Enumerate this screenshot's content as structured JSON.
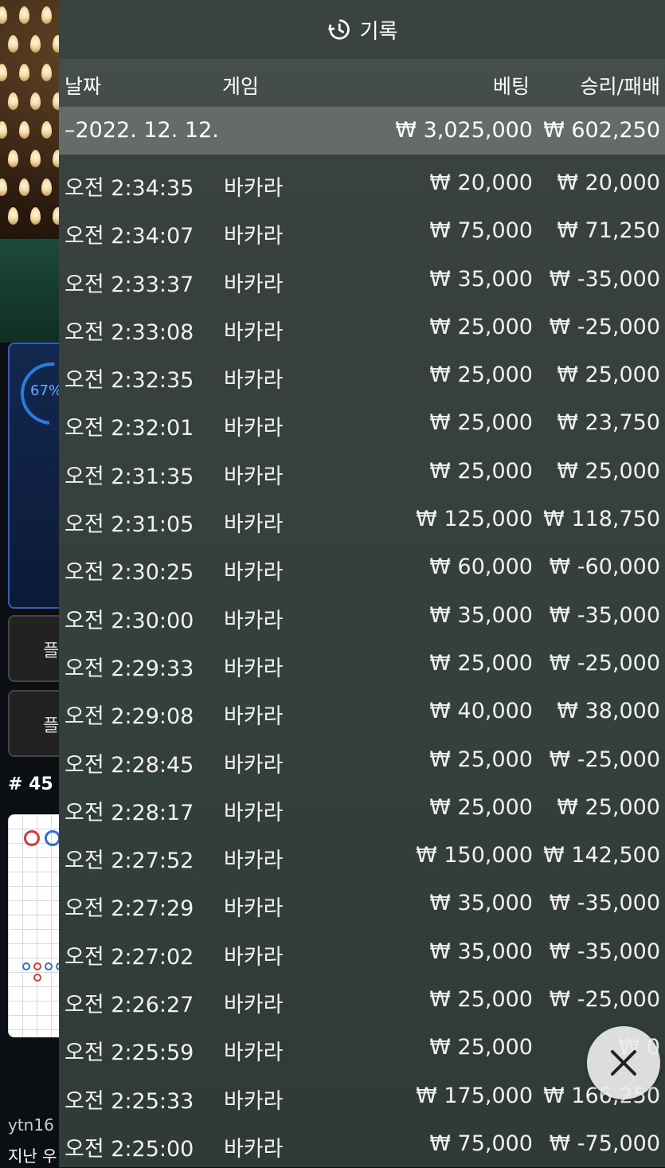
{
  "header": {
    "title": "기록",
    "icon": "history-icon"
  },
  "columns": {
    "date": "날짜",
    "game": "게임",
    "bet": "베팅",
    "result": "승리/패배"
  },
  "summary": {
    "date": "–2022. 12. 12.",
    "bet": "₩ 3,025,000",
    "result": "₩ 602,250"
  },
  "rows": [
    {
      "time": "오전 2:34:35",
      "game": "바카라",
      "bet": "₩ 20,000",
      "result": "₩ 20,000"
    },
    {
      "time": "오전 2:34:07",
      "game": "바카라",
      "bet": "₩ 75,000",
      "result": "₩ 71,250"
    },
    {
      "time": "오전 2:33:37",
      "game": "바카라",
      "bet": "₩ 35,000",
      "result": "₩ -35,000"
    },
    {
      "time": "오전 2:33:08",
      "game": "바카라",
      "bet": "₩ 25,000",
      "result": "₩ -25,000"
    },
    {
      "time": "오전 2:32:35",
      "game": "바카라",
      "bet": "₩ 25,000",
      "result": "₩ 25,000"
    },
    {
      "time": "오전 2:32:01",
      "game": "바카라",
      "bet": "₩ 25,000",
      "result": "₩ 23,750"
    },
    {
      "time": "오전 2:31:35",
      "game": "바카라",
      "bet": "₩ 25,000",
      "result": "₩ 25,000"
    },
    {
      "time": "오전 2:31:05",
      "game": "바카라",
      "bet": "₩ 125,000",
      "result": "₩ 118,750"
    },
    {
      "time": "오전 2:30:25",
      "game": "바카라",
      "bet": "₩ 60,000",
      "result": "₩ -60,000"
    },
    {
      "time": "오전 2:30:00",
      "game": "바카라",
      "bet": "₩ 35,000",
      "result": "₩ -35,000"
    },
    {
      "time": "오전 2:29:33",
      "game": "바카라",
      "bet": "₩ 25,000",
      "result": "₩ -25,000"
    },
    {
      "time": "오전 2:29:08",
      "game": "바카라",
      "bet": "₩ 40,000",
      "result": "₩ 38,000"
    },
    {
      "time": "오전 2:28:45",
      "game": "바카라",
      "bet": "₩ 25,000",
      "result": "₩ -25,000"
    },
    {
      "time": "오전 2:28:17",
      "game": "바카라",
      "bet": "₩ 25,000",
      "result": "₩ 25,000"
    },
    {
      "time": "오전 2:27:52",
      "game": "바카라",
      "bet": "₩ 150,000",
      "result": "₩ 142,500"
    },
    {
      "time": "오전 2:27:29",
      "game": "바카라",
      "bet": "₩ 35,000",
      "result": "₩ -35,000"
    },
    {
      "time": "오전 2:27:02",
      "game": "바카라",
      "bet": "₩ 35,000",
      "result": "₩ -35,000"
    },
    {
      "time": "오전 2:26:27",
      "game": "바카라",
      "bet": "₩ 25,000",
      "result": "₩ -25,000"
    },
    {
      "time": "오전 2:25:59",
      "game": "바카라",
      "bet": "₩ 25,000",
      "result": "₩ 0"
    },
    {
      "time": "오전 2:25:33",
      "game": "바카라",
      "bet": "₩ 175,000",
      "result": "₩ 166,250"
    },
    {
      "time": "오전 2:25:00",
      "game": "바카라",
      "bet": "₩ 75,000",
      "result": "₩ -75,000"
    }
  ],
  "background": {
    "progress": "67%",
    "round": "# 45",
    "button1": "플",
    "button2": "플",
    "chat_user": "ytn16",
    "chat_line": "지난 우"
  },
  "close_icon": "close-icon",
  "colors": {
    "overlay": "#3a423e",
    "panel_border": "#2c5ec4",
    "accent_blue": "#2a7de0",
    "road_red": "#d63b3b",
    "road_blue": "#2f6fd6"
  }
}
